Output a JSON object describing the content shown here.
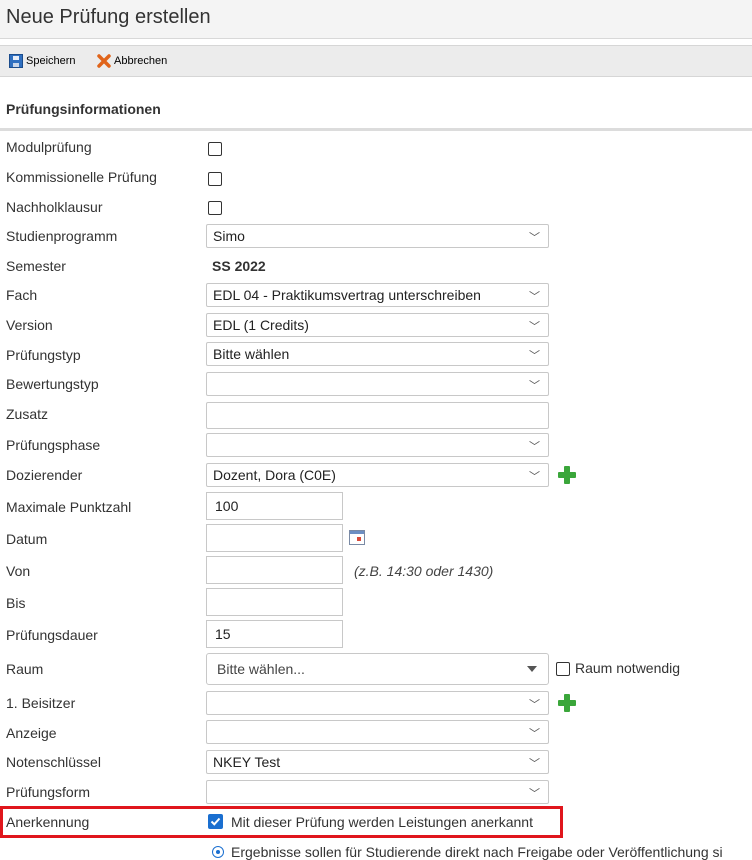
{
  "page": {
    "title": "Neue Prüfung erstellen"
  },
  "toolbar": {
    "save_label": "Speichern",
    "cancel_label": "Abbrechen"
  },
  "section": {
    "title": "Prüfungsinformationen"
  },
  "fields": {
    "modulpruefung": {
      "label": "Modulprüfung",
      "checked": false
    },
    "kommissionell": {
      "label": "Kommissionelle Prüfung",
      "checked": false
    },
    "nachholklausur": {
      "label": "Nachholklausur",
      "checked": false
    },
    "studienprogramm": {
      "label": "Studienprogramm",
      "value": "Simo"
    },
    "semester": {
      "label": "Semester",
      "value": "SS 2022"
    },
    "fach": {
      "label": "Fach",
      "value": "EDL 04 - Praktikumsvertrag unterschreiben"
    },
    "version": {
      "label": "Version",
      "value": "EDL (1 Credits)"
    },
    "pruefungstyp": {
      "label": "Prüfungstyp",
      "value": "Bitte wählen"
    },
    "bewertungstyp": {
      "label": "Bewertungstyp",
      "value": ""
    },
    "zusatz": {
      "label": "Zusatz",
      "value": ""
    },
    "pruefungsphase": {
      "label": "Prüfungsphase",
      "value": ""
    },
    "dozierender": {
      "label": "Dozierender",
      "value": "Dozent, Dora (C0E)"
    },
    "max_punktzahl": {
      "label": "Maximale Punktzahl",
      "value": "100"
    },
    "datum": {
      "label": "Datum",
      "value": ""
    },
    "von": {
      "label": "Von",
      "value": "",
      "hint": "(z.B. 14:30 oder 1430)"
    },
    "bis": {
      "label": "Bis",
      "value": ""
    },
    "pruefungsdauer": {
      "label": "Prüfungsdauer",
      "value": "15"
    },
    "raum": {
      "label": "Raum",
      "value": "Bitte wählen...",
      "notwendig_label": "Raum notwendig"
    },
    "beisitzer": {
      "label": "1. Beisitzer",
      "value": ""
    },
    "anzeige": {
      "label": "Anzeige",
      "value": ""
    },
    "notenschluessel": {
      "label": "Notenschlüssel",
      "value": "NKEY Test"
    },
    "pruefungsform": {
      "label": "Prüfungsform",
      "value": ""
    },
    "anerkennung": {
      "label": "Anerkennung",
      "checkbox_label": "Mit dieser Prüfung werden Leistungen anerkannt",
      "checked": true
    }
  },
  "ergebnisse": {
    "text": "Ergebnisse sollen für Studierende direkt nach Freigabe oder Veröffentlichung si"
  },
  "colors": {
    "accent": "#1a6fd0",
    "highlight": "#e0161c",
    "add": "#3aa63a"
  },
  "icons": {
    "save": "floppy-disk-icon",
    "cancel": "cancel-x-icon",
    "add": "plus-icon",
    "calendar": "calendar-icon"
  }
}
